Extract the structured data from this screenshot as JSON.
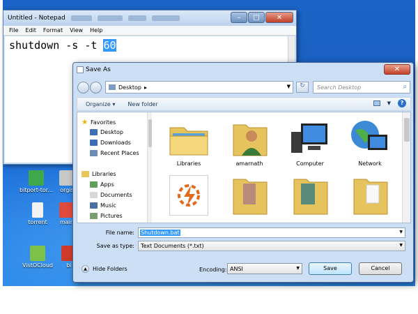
{
  "notepad": {
    "title": "Untitled - Notepad",
    "menu": [
      "File",
      "Edit",
      "Format",
      "View",
      "Help"
    ],
    "text_command": "shutdown -s -t ",
    "text_selected": "60",
    "controls": [
      "–",
      "□",
      "✕"
    ]
  },
  "desktop": {
    "icons": [
      "bitport-tor...",
      "orgis",
      "torrent",
      "main",
      "VistOCloud",
      "bi"
    ]
  },
  "dialog": {
    "title": "Save As",
    "close_glyph": "✕",
    "address": "Desktop",
    "address_chevron": "▸",
    "search_placeholder": "Search Desktop",
    "toolbar": {
      "organize": "Organize ▾",
      "new_folder": "New folder",
      "help": "?"
    },
    "nav": {
      "favorites": "Favorites",
      "desktop": "Desktop",
      "downloads": "Downloads",
      "recent_places": "Recent Places",
      "libraries": "Libraries",
      "apps": "Apps",
      "documents": "Documents",
      "music": "Music",
      "pictures": "Pictures"
    },
    "items": [
      "Libraries",
      "amarnath",
      "Computer",
      "Network"
    ],
    "file_name_label": "File name:",
    "file_name_value": "Shutdown.bat",
    "save_type_label": "Save as type:",
    "save_type_value": "Text Documents (*.txt)",
    "hide_folders": "Hide Folders",
    "encoding_label": "Encoding:",
    "encoding_value": "ANSI",
    "save_button": "Save",
    "cancel_button": "Cancel"
  }
}
